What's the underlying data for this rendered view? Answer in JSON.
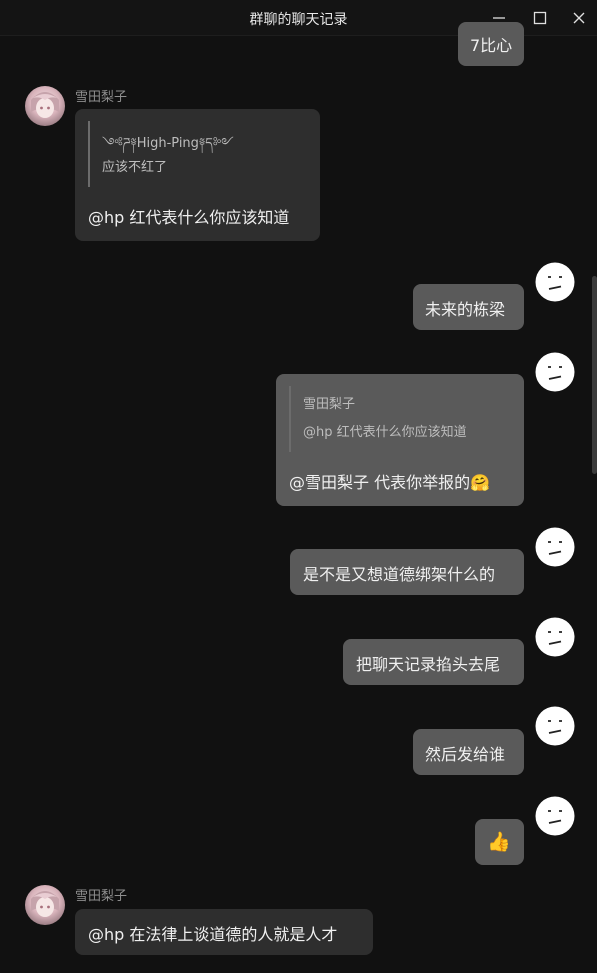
{
  "window": {
    "title": "群聊的聊天记录",
    "minimize_icon": "minimize-icon",
    "maximize_icon": "maximize-icon",
    "close_icon": "close-icon"
  },
  "colors": {
    "background": "#111111",
    "peer_bubble": "#2e2e2e",
    "self_bubble": "#5a5a5a",
    "sender_name": "#8e8e8e"
  },
  "messages": [
    {
      "from": "self",
      "text": "7比心"
    },
    {
      "from": "peer",
      "sender": "雪田梨子",
      "quote": {
        "author": "༺ཌ༈High-Ping༈ད༻",
        "text": "应该不红了"
      },
      "text": "@hp 红代表什么你应该知道"
    },
    {
      "from": "self",
      "text": "未来的栋梁"
    },
    {
      "from": "self",
      "quote": {
        "author": "雪田梨子",
        "text": "@hp 红代表什么你应该知道"
      },
      "text": "@雪田梨子 代表你举报的🤗"
    },
    {
      "from": "self",
      "text": "是不是又想道德绑架什么的"
    },
    {
      "from": "self",
      "text": "把聊天记录掐头去尾"
    },
    {
      "from": "self",
      "text": "然后发给谁"
    },
    {
      "from": "self",
      "text": "👍"
    },
    {
      "from": "peer",
      "sender": "雪田梨子",
      "text": "@hp 在法律上谈道德的人就是人才"
    }
  ],
  "avatars": {
    "peer_icon": "anime-girl-avatar",
    "self_icon": "neutral-face-avatar"
  }
}
